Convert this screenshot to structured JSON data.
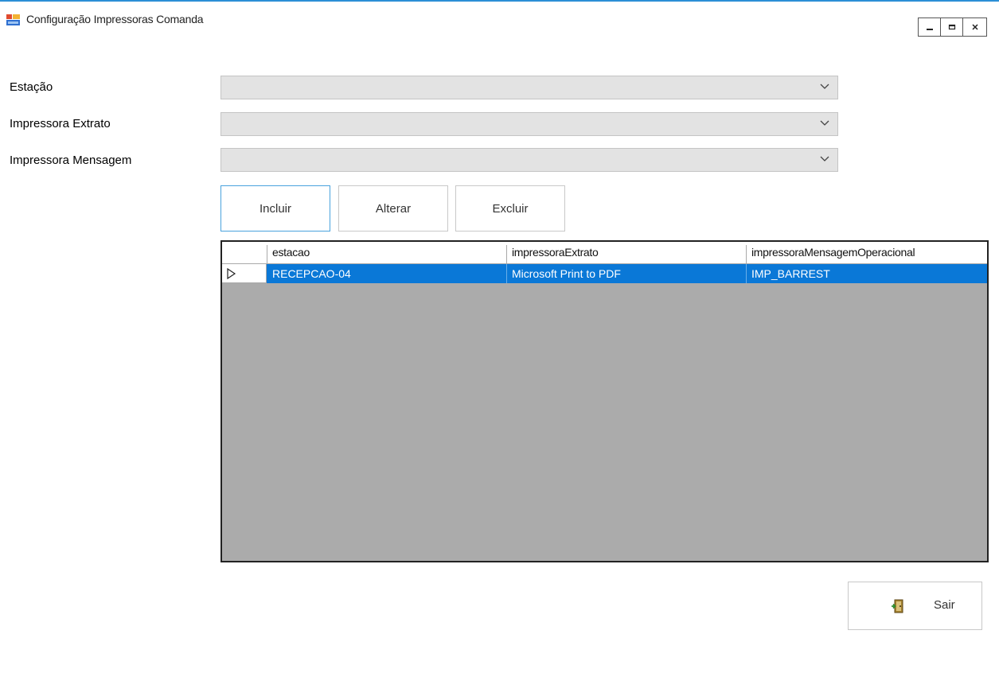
{
  "window": {
    "title": "Configuração Impressoras Comanda",
    "icon": "app-window-icon",
    "controls": [
      "minimize-icon",
      "maximize-icon",
      "close-icon"
    ],
    "accent_color": "#2b8fd6"
  },
  "form": {
    "estacao_label": "Estação",
    "estacao_value": "",
    "impressora_extrato_label": "Impressora Extrato",
    "impressora_extrato_value": "",
    "impressora_mensagem_label": "Impressora Mensagem",
    "impressora_mensagem_value": ""
  },
  "actions": {
    "incluir": "Incluir",
    "alterar": "Alterar",
    "excluir": "Excluir"
  },
  "grid": {
    "columns": [
      "estacao",
      "impressoraExtrato",
      "impressoraMensagemOperacional"
    ],
    "rows": [
      {
        "estacao": "RECEPCAO-04",
        "impressoraExtrato": "Microsoft Print to PDF",
        "impressoraMensagemOperacional": "IMP_BARREST",
        "selected": true
      }
    ],
    "selection_color": "#0a78d7",
    "background_color": "#ababab"
  },
  "footer": {
    "sair_label": "Sair",
    "sair_icon": "exit-door-icon"
  }
}
